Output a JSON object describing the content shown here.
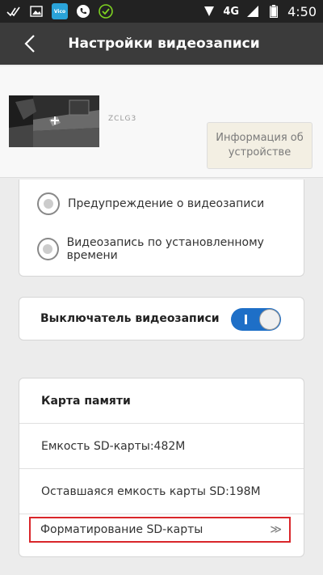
{
  "statusbar": {
    "network": "4G",
    "time": "4:50",
    "app_icon_text": "Vicohome"
  },
  "header": {
    "title": "Настройки видеозаписи"
  },
  "device": {
    "name": "ZCLG3",
    "info_button": "Информация об устройстве"
  },
  "recording_mode": {
    "options": [
      {
        "label": "Предупреждение о видеозаписи"
      },
      {
        "label": "Видеозапись по установленному времени"
      }
    ]
  },
  "recording_switch": {
    "label": "Выключатель видеозаписи",
    "enabled": true
  },
  "memory_card": {
    "title": "Карта памяти",
    "capacity": "Емкость SD-карты:482M",
    "remaining": "Оставшаяся емкость карты SD:198M",
    "format_label": "Форматирование SD-карты",
    "format_chevron": "≫"
  },
  "colors": {
    "topbar": "#3b3b3b",
    "switch_on": "#1e6fc7",
    "highlight": "#d9262a"
  }
}
